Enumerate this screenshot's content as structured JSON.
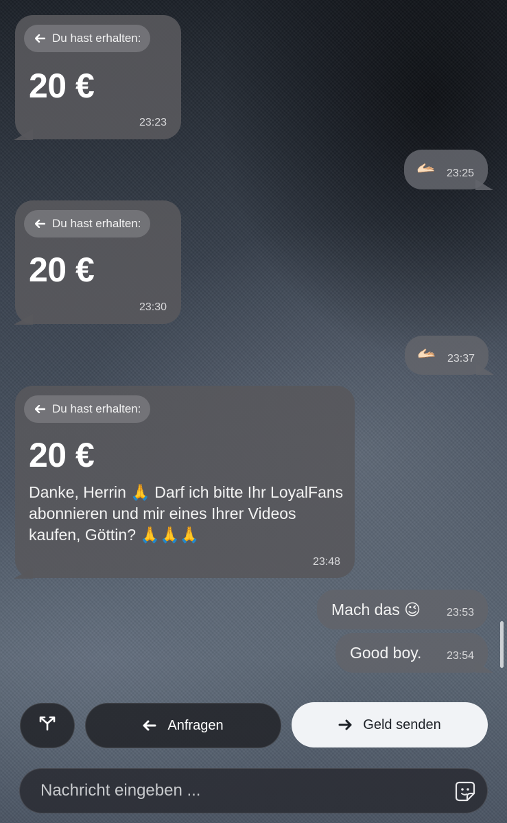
{
  "messages": [
    {
      "received_label": "Du hast erhalten:",
      "amount": "20 €",
      "time": "23:23"
    },
    {
      "emoji": "🫴🏻",
      "time": "23:25"
    },
    {
      "received_label": "Du hast erhalten:",
      "amount": "20 €",
      "time": "23:30"
    },
    {
      "emoji": "🫴🏻",
      "time": "23:37"
    },
    {
      "received_label": "Du hast erhalten:",
      "amount": "20 €",
      "text": "Danke, Herrin 🙏 Darf ich bitte Ihr LoyalFans abonnieren und mir eines Ihrer Videos kaufen, Göttin? 🙏🙏🙏",
      "time": "23:48"
    },
    {
      "text": "Mach das 😉",
      "time": "23:53"
    },
    {
      "text": "Good boy.",
      "time": "23:54"
    }
  ],
  "actions": {
    "split_icon": "split-icon",
    "request_label": "Anfragen",
    "send_money_label": "Geld senden"
  },
  "composer": {
    "placeholder": "Nachricht eingeben ...",
    "sticker_icon": "sticker-icon"
  },
  "colors": {
    "incoming_bubble": "#58585c",
    "outgoing_bubble": "#626469",
    "primary_button": "#f1f3f6"
  }
}
